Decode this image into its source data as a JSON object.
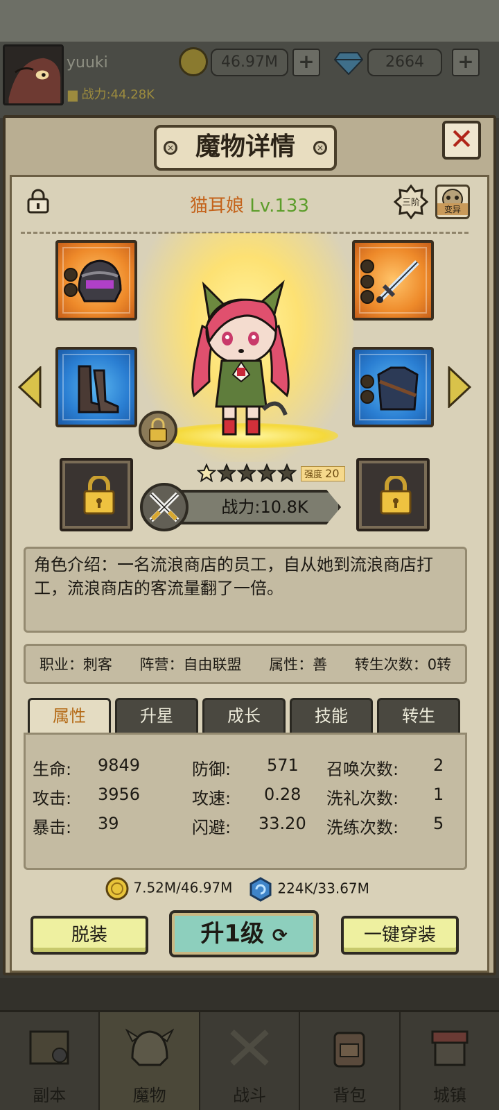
{
  "player": {
    "name": "yuuki",
    "power": "战力:44.28K",
    "gold": "46.97M",
    "gems": "2664",
    "plus": "+"
  },
  "dialog": {
    "title": "魔物详情",
    "close": "✕"
  },
  "monster": {
    "name": "猫耳娘",
    "level": "Lv.133",
    "tier": "三阶",
    "mutate": "变异",
    "stars_filled": 1,
    "stars_total": 5,
    "strength_label": "强度",
    "strength_value": "20",
    "power": "战力:10.8K",
    "description": "角色介绍：一名流浪商店的员工，自从她到流浪商店打工，流浪商店的客流量翻了一倍。",
    "info": [
      "职业：刺客",
      "阵营：自由联盟",
      "属性：善",
      "转生次数：0转"
    ]
  },
  "tabs": [
    "属性",
    "升星",
    "成长",
    "技能",
    "转生"
  ],
  "active_tab": "属性",
  "stats": {
    "hp_label": "生命:",
    "hp": "9849",
    "atk_label": "攻击:",
    "atk": "3956",
    "crit_label": "暴击:",
    "crit": "39",
    "def_label": "防御:",
    "def": "571",
    "spd_label": "攻速:",
    "spd": "0.28",
    "dodge_label": "闪避:",
    "dodge": "33.20",
    "summon_label": "召唤次数:",
    "summon": "2",
    "baptize_label": "洗礼次数:",
    "baptize": "1",
    "refine_label": "洗练次数:",
    "refine": "5"
  },
  "costs": {
    "gold": "7.52M/46.97M",
    "essence": "224K/33.67M"
  },
  "buttons": {
    "unequip": "脱装",
    "levelup": "升1级",
    "equip_all": "一键穿装"
  },
  "nav": [
    "副本",
    "魔物",
    "战斗",
    "背包",
    "城镇"
  ],
  "colors": {
    "level": "#5c9d2a",
    "name": "#c4631b",
    "active_tab_text": "#b46a16",
    "levelup_btn": "#8dcfbd",
    "side_btn": "#eef0a0"
  }
}
